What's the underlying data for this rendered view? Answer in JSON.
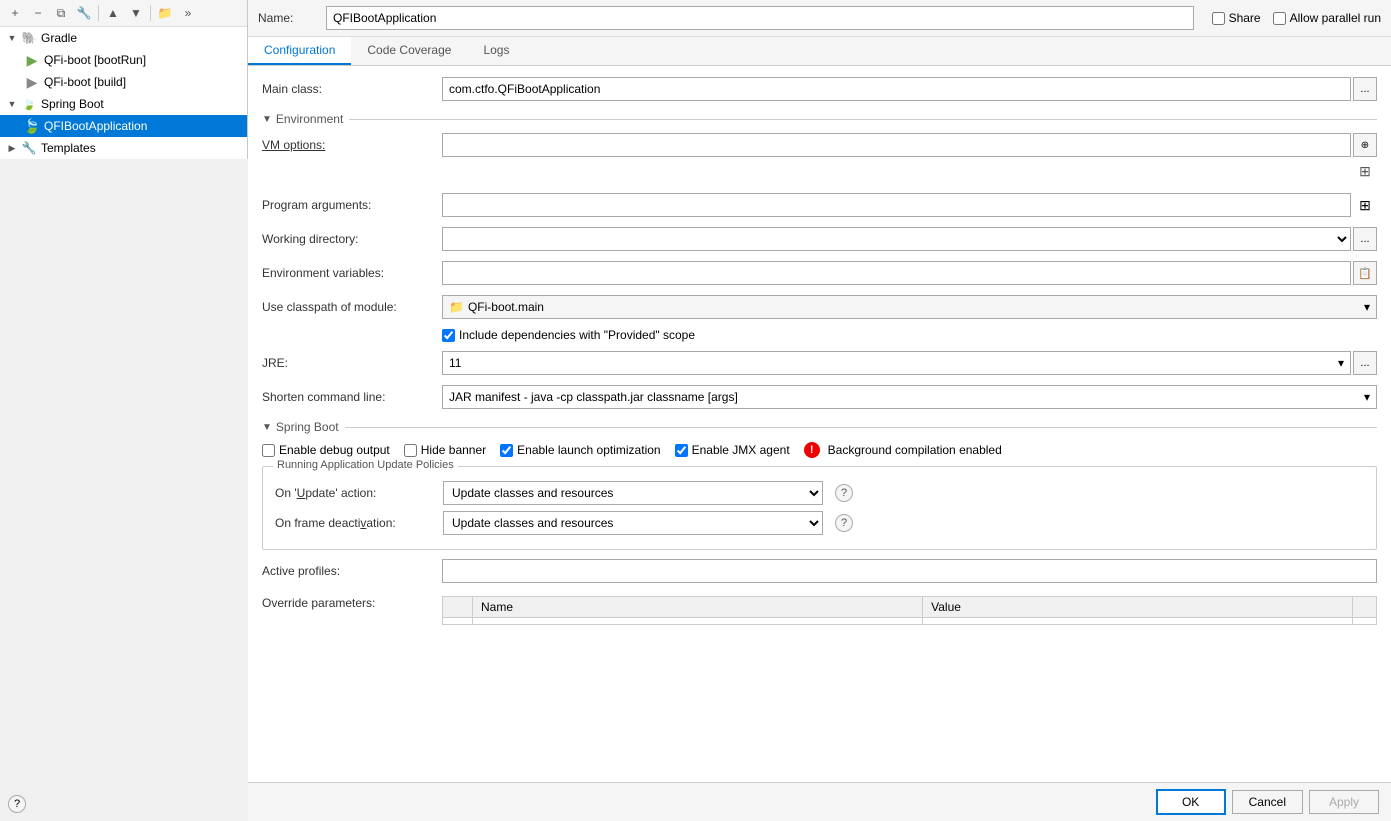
{
  "toolbar": {
    "add_icon": "+",
    "remove_icon": "−",
    "copy_icon": "⧉",
    "settings_icon": "🔧",
    "up_icon": "▲",
    "down_icon": "▼",
    "folder_icon": "📁",
    "more_icon": "»"
  },
  "sidebar": {
    "items": [
      {
        "id": "gradle",
        "label": "Gradle",
        "icon": "gradle",
        "indent": 0,
        "expandable": true,
        "expanded": true
      },
      {
        "id": "qfi-boot-run",
        "label": "QFi-boot [bootRun]",
        "icon": "run",
        "indent": 1,
        "expandable": false
      },
      {
        "id": "qfi-boot-build",
        "label": "QFi-boot [build]",
        "icon": "build",
        "indent": 1,
        "expandable": false
      },
      {
        "id": "spring-boot",
        "label": "Spring Boot",
        "icon": "spring",
        "indent": 0,
        "expandable": true,
        "expanded": true,
        "selected": false
      },
      {
        "id": "qfi-boot-app",
        "label": "QFIBootApplication",
        "icon": "spring",
        "indent": 1,
        "expandable": false,
        "selected": true
      },
      {
        "id": "templates",
        "label": "Templates",
        "icon": "template",
        "indent": 0,
        "expandable": true,
        "selected": false
      }
    ]
  },
  "header": {
    "name_label": "Name:",
    "name_value": "QFIBootApplication",
    "share_label": "Share",
    "allow_parallel_label": "Allow parallel run"
  },
  "tabs": [
    {
      "id": "configuration",
      "label": "Configuration",
      "active": true
    },
    {
      "id": "code-coverage",
      "label": "Code Coverage",
      "active": false
    },
    {
      "id": "logs",
      "label": "Logs",
      "active": false
    }
  ],
  "form": {
    "main_class_label": "Main class:",
    "main_class_value": "com.ctfo.QFiBootApplication",
    "environment_label": "Environment",
    "vm_options_label": "VM options:",
    "vm_options_value": "",
    "program_args_label": "Program arguments:",
    "program_args_value": "",
    "working_dir_label": "Working directory:",
    "working_dir_value": "",
    "env_vars_label": "Environment variables:",
    "env_vars_value": "",
    "use_classpath_label": "Use classpath of module:",
    "use_classpath_value": "QFi-boot.main",
    "include_deps_label": "Include dependencies with \"Provided\" scope",
    "jre_label": "JRE:",
    "jre_value": "11",
    "shorten_cmd_label": "Shorten command line:",
    "shorten_cmd_value": "JAR manifest - java -cp classpath.jar classname [args]",
    "spring_boot_label": "Spring Boot",
    "enable_debug_label": "Enable debug output",
    "enable_debug_checked": false,
    "hide_banner_label": "Hide banner",
    "hide_banner_checked": false,
    "enable_launch_label": "Enable launch optimization",
    "enable_launch_checked": true,
    "enable_jmx_label": "Enable JMX agent",
    "enable_jmx_checked": true,
    "background_compilation_label": "Background compilation enabled",
    "running_app_policies_title": "Running Application Update Policies",
    "on_update_label": "On 'Update' action:",
    "on_update_value": "Update classes and resources",
    "on_frame_label": "On frame deactivation:",
    "on_frame_value": "Update classes and resources",
    "active_profiles_label": "Active profiles:",
    "active_profiles_value": "",
    "override_params_label": "Override parameters:",
    "name_col": "Name",
    "value_col": "Value"
  },
  "buttons": {
    "ok_label": "OK",
    "cancel_label": "Cancel",
    "apply_label": "Apply"
  },
  "icons": {
    "help": "?",
    "dots": "...",
    "expand_vert": "⊕",
    "error": "!",
    "dropdown": "▾",
    "checkbox_checked": "✓"
  }
}
